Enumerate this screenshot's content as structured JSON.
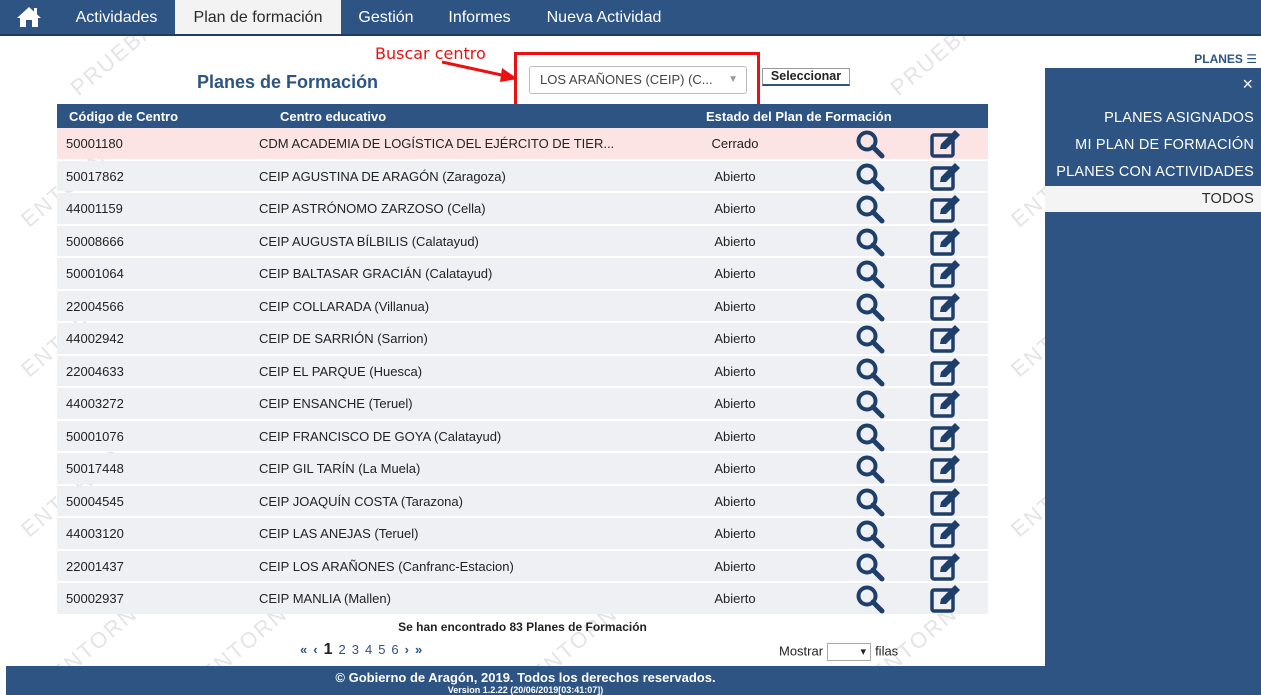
{
  "nav": {
    "home_icon": "home-icon",
    "tabs": [
      {
        "label": "Actividades",
        "active": false
      },
      {
        "label": "Plan de formación",
        "active": true
      },
      {
        "label": "Gestión",
        "active": false
      },
      {
        "label": "Informes",
        "active": false
      },
      {
        "label": "Nueva Actividad",
        "active": false
      }
    ]
  },
  "watermark": [
    "PRUEBAS",
    "ENTORNO"
  ],
  "page": {
    "title": "Planes de Formación",
    "annotation": "Buscar centro",
    "select_value": "LOS ARAÑONES (CEIP) (C...",
    "select_button": "Seleccionar"
  },
  "table": {
    "headers": [
      "Código de Centro",
      "Centro educativo",
      "Estado del Plan de Formación"
    ],
    "rows": [
      {
        "code": "50001180",
        "name": "CDM ACADEMIA DE LOGÍSTICA DEL EJÉRCITO DE TIER...",
        "status": "Cerrado"
      },
      {
        "code": "50017862",
        "name": "CEIP AGUSTINA DE ARAGÓN (Zaragoza)",
        "status": "Abierto"
      },
      {
        "code": "44001159",
        "name": "CEIP ASTRÓNOMO ZARZOSO (Cella)",
        "status": "Abierto"
      },
      {
        "code": "50008666",
        "name": "CEIP AUGUSTA BÍLBILIS (Calatayud)",
        "status": "Abierto"
      },
      {
        "code": "50001064",
        "name": "CEIP BALTASAR GRACIÁN (Calatayud)",
        "status": "Abierto"
      },
      {
        "code": "22004566",
        "name": "CEIP COLLARADA (Villanua)",
        "status": "Abierto"
      },
      {
        "code": "44002942",
        "name": "CEIP DE SARRIÓN (Sarrion)",
        "status": "Abierto"
      },
      {
        "code": "22004633",
        "name": "CEIP EL PARQUE (Huesca)",
        "status": "Abierto"
      },
      {
        "code": "44003272",
        "name": "CEIP ENSANCHE (Teruel)",
        "status": "Abierto"
      },
      {
        "code": "50001076",
        "name": "CEIP FRANCISCO DE GOYA (Calatayud)",
        "status": "Abierto"
      },
      {
        "code": "50017448",
        "name": "CEIP GIL TARÍN (La Muela)",
        "status": "Abierto"
      },
      {
        "code": "50004545",
        "name": "CEIP JOAQUÍN COSTA (Tarazona)",
        "status": "Abierto"
      },
      {
        "code": "44003120",
        "name": "CEIP LAS ANEJAS (Teruel)",
        "status": "Abierto"
      },
      {
        "code": "22001437",
        "name": "CEIP LOS ARAÑONES (Canfranc-Estacion)",
        "status": "Abierto"
      },
      {
        "code": "50002937",
        "name": "CEIP MANLIA (Mallen)",
        "status": "Abierto"
      }
    ],
    "found_text": "Se han encontrado 83 Planes de Formación"
  },
  "pager": {
    "first": "«",
    "prev": "‹",
    "pages": [
      "1",
      "2",
      "3",
      "4",
      "5",
      "6"
    ],
    "current": "1",
    "next": "›",
    "last": "»"
  },
  "rows_selector": {
    "label_before": "Mostrar",
    "label_after": "filas",
    "value": ""
  },
  "sidepanel": {
    "toggle_label": "PLANES ☰",
    "close": "×",
    "items": [
      {
        "label": "PLANES ASIGNADOS",
        "selected": false
      },
      {
        "label": "MI PLAN DE FORMACIÓN",
        "selected": false
      },
      {
        "label": "PLANES CON ACTIVIDADES",
        "selected": false
      },
      {
        "label": "TODOS",
        "selected": true
      }
    ]
  },
  "footer": {
    "line1": "© Gobierno de Aragón, 2019. Todos los derechos reservados.",
    "line2": "Version 1.2.22 (20/06/2019[03:41:07])"
  },
  "colors": {
    "brand": "#2d5482",
    "highlight": "#e81212",
    "closed_row": "#fce4e4"
  }
}
